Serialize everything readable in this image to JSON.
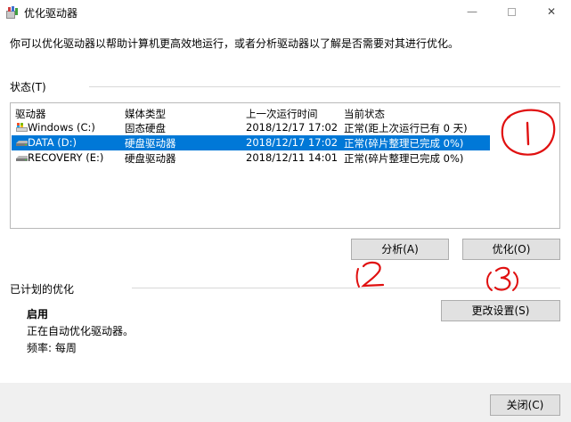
{
  "window": {
    "title": "优化驱动器",
    "minimize_glyph": "—",
    "close_glyph": "✕"
  },
  "description": "你可以优化驱动器以帮助计算机更高效地运行，或者分析驱动器以了解是否需要对其进行优化。",
  "status_section": {
    "label": "状态(T)",
    "columns": [
      "驱动器",
      "媒体类型",
      "上一次运行时间",
      "当前状态"
    ],
    "rows": [
      {
        "drive": "Windows (C:)",
        "media": "固态硬盘",
        "last_run": "2018/12/17 17:02",
        "status": "正常(距上次运行已有 0 天)",
        "icon": "windows-drive-icon",
        "selected": false
      },
      {
        "drive": "DATA (D:)",
        "media": "硬盘驱动器",
        "last_run": "2018/12/17 17:02",
        "status": "正常(碎片整理已完成 0%)",
        "icon": "hard-drive-icon",
        "selected": true
      },
      {
        "drive": "RECOVERY (E:)",
        "media": "硬盘驱动器",
        "last_run": "2018/12/11 14:01",
        "status": "正常(碎片整理已完成 0%)",
        "icon": "hard-drive-icon",
        "selected": false
      }
    ]
  },
  "buttons": {
    "analyze": "分析(A)",
    "optimize": "优化(O)",
    "change_settings": "更改设置(S)",
    "close": "关闭(C)"
  },
  "schedule": {
    "label": "已计划的优化",
    "state": "启用",
    "detail": "正在自动优化驱动器。",
    "frequency": "频率: 每周"
  },
  "colors": {
    "selection": "#0078d7",
    "annotation_ink": "#e01010"
  }
}
